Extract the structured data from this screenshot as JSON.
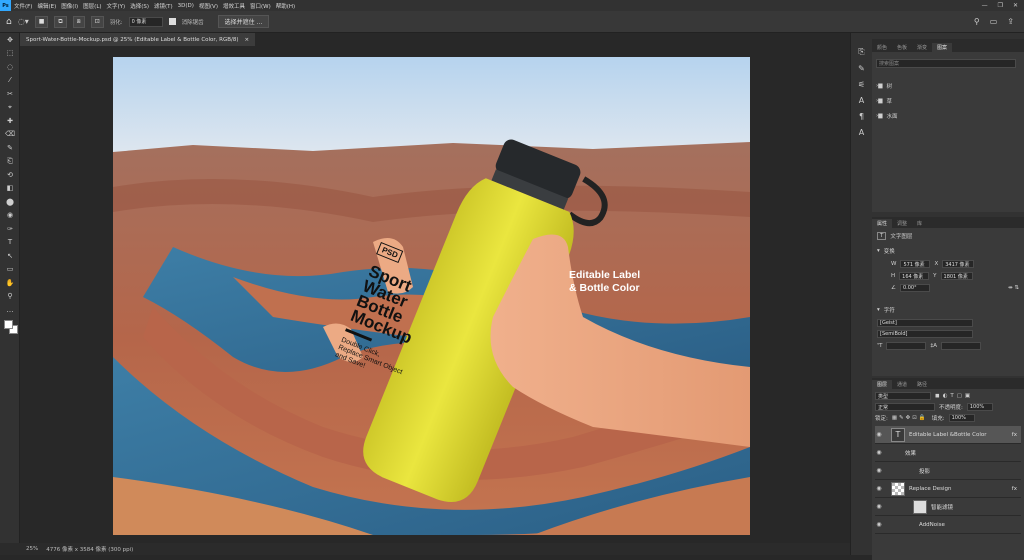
{
  "menu": {
    "logo": "Ps",
    "items": [
      "文件(F)",
      "编辑(E)",
      "图像(I)",
      "图层(L)",
      "文字(Y)",
      "选择(S)",
      "滤镜(T)",
      "3D(D)",
      "视图(V)",
      "增效工具",
      "窗口(W)",
      "帮助(H)"
    ],
    "min": "—",
    "max": "❐",
    "close": "✕"
  },
  "options": {
    "feather_label": "羽化:",
    "feather_value": "0 像素",
    "antialias_label": "消除锯齿",
    "select_mask_label": "选择并遮住 ..."
  },
  "tools": [
    "✥",
    "⬚",
    "◌",
    "⁄",
    "✂",
    "⌖",
    "✚",
    "⌫",
    "✎",
    "⎗",
    "⟲",
    "◧",
    "⬤",
    "◉",
    "✑",
    "T",
    "↖",
    "▭",
    "✋",
    "⚲",
    "…"
  ],
  "document": {
    "tab_title": "Sport-Water-Bottle-Mockup.psd @ 25% (Editable Label & Bottle Color, RGB/8)",
    "tab_close": "×"
  },
  "bottle": {
    "badge": "PSD",
    "line1": "Sport",
    "line2": "Water",
    "line3": "Bottle",
    "line4": "Mockup",
    "sub1": "Double Click,",
    "sub2": "Replace Smart Object",
    "sub3": "and Save!"
  },
  "overlay": {
    "line1": "Editable Label",
    "line2": "& Bottle Color"
  },
  "status": {
    "zoom": "25%",
    "size": "4776 像素 x 3584 像素 (300 ppi)"
  },
  "panels": {
    "top_tabs": [
      "颜色",
      "色板",
      "渐变",
      "图案"
    ],
    "active_top_tab": "图案",
    "pattern_search": "搜索图案",
    "pattern_folders": [
      "树",
      "草",
      "水面"
    ],
    "props_tabs": [
      "属性",
      "调整",
      "库"
    ],
    "props_kind": "文字图层",
    "transform_label": "变换",
    "w_label": "W",
    "w_value": "571 像素",
    "x_label": "X",
    "x_value": "3417 像素",
    "h_label": "H",
    "h_value": "164 像素",
    "y_label": "Y",
    "y_value": "1801 像素",
    "angle_value": "0.00°",
    "char_label": "字符",
    "font_family": "[Geist]",
    "font_style": "[SemiBold]",
    "layers_tabs": [
      "图层",
      "通道",
      "路径"
    ],
    "kind_label": "类型",
    "blend_mode": "正常",
    "opacity_label": "不透明度:",
    "opacity_value": "100%",
    "lock_label": "锁定:",
    "fill_label": "填充:",
    "fill_value": "100%",
    "layers": [
      {
        "name": "Editable Label &Bottle Color",
        "kind": "text"
      },
      {
        "name": "效果",
        "kind": "sub"
      },
      {
        "name": "投影",
        "kind": "subsub"
      },
      {
        "name": "Replace Design",
        "kind": "smart"
      },
      {
        "name": "智能滤镜",
        "kind": "filter"
      },
      {
        "name": "AddNoise",
        "kind": "subsub"
      }
    ]
  },
  "colors": {
    "accent": "#31a8ff",
    "bottle": "#e6e23a"
  }
}
